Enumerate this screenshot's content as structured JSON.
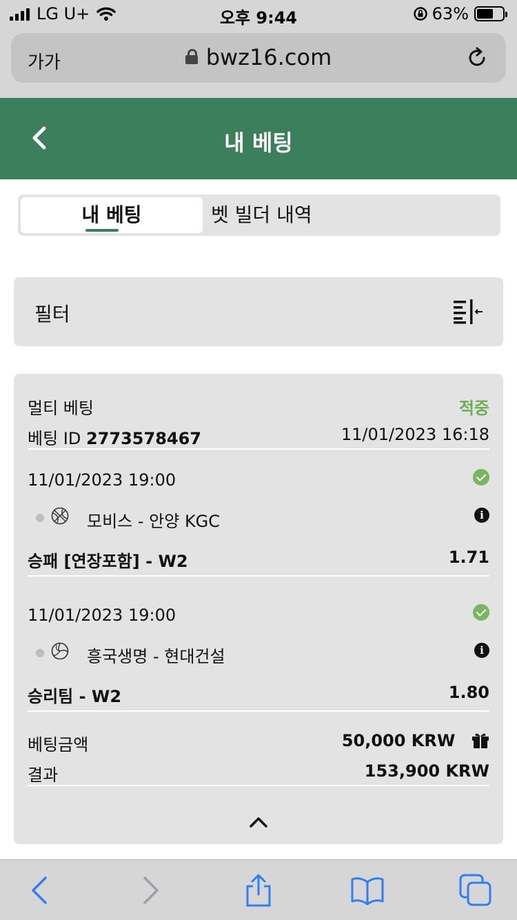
{
  "status_bar": {
    "carrier": "LG U+",
    "time": "오후 9:44",
    "battery": "63%",
    "battery_level": 0.63
  },
  "browser": {
    "text_size_label": "가가",
    "url": "bwz16.com"
  },
  "header": {
    "title": "내 베팅"
  },
  "tabs": [
    {
      "label": "내 베팅",
      "active": true
    },
    {
      "label": "벳 빌더 내역",
      "active": false
    }
  ],
  "filter": {
    "label": "필터"
  },
  "bet": {
    "type": "멀티 베팅",
    "status": "적중",
    "id_label": "베팅 ID",
    "id": "2773578467",
    "placed_at": "11/01/2023 16:18",
    "selections": [
      {
        "datetime": "11/01/2023 19:00",
        "sport_icon": "basketball-icon",
        "match": "모비스 - 안양 KGC",
        "market": "승패 [연장포함] - W2",
        "odds": "1.71"
      },
      {
        "datetime": "11/01/2023 19:00",
        "sport_icon": "volleyball-icon",
        "match": "흥국생명 - 현대건설",
        "market": "승리팀 - W2",
        "odds": "1.80"
      }
    ],
    "stake_label": "베팅금액",
    "stake": "50,000 KRW",
    "result_label": "결과",
    "result": "153,900 KRW"
  },
  "colors": {
    "brand_green": "#3b7f5c",
    "win_green": "#6fae52",
    "ios_blue": "#2f7ef5"
  }
}
